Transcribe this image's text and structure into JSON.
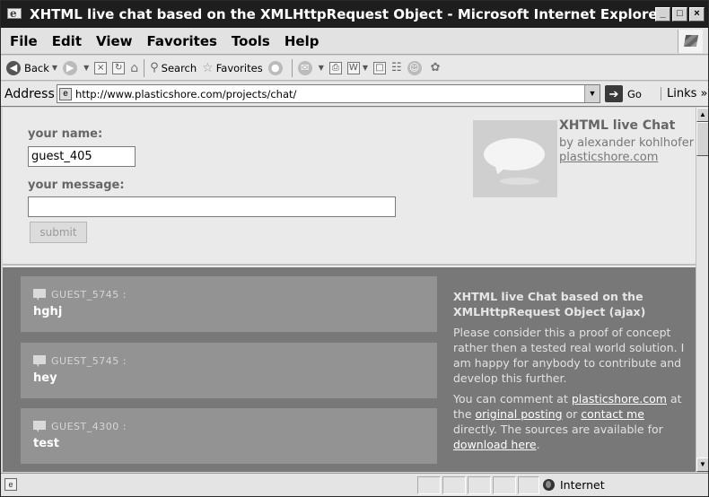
{
  "window": {
    "title": "XHTML live chat based on the XMLHttpRequest Object - Microsoft Internet Explorer",
    "controls": [
      "_",
      "□",
      "×"
    ]
  },
  "menu": [
    "File",
    "Edit",
    "View",
    "Favorites",
    "Tools",
    "Help"
  ],
  "toolbar": {
    "back": "Back",
    "search": "Search",
    "favorites": "Favorites"
  },
  "address": {
    "label": "Address",
    "url": "http://www.plasticshore.com/projects/chat/",
    "go": "Go",
    "links": "Links »"
  },
  "form": {
    "name_label": "your name:",
    "name_value": "guest_405",
    "message_label": "your message:",
    "message_value": "",
    "submit": "submit"
  },
  "brand": {
    "title": "XHTML live Chat",
    "by": "by alexander kohlhofer",
    "link": "plasticshore.com"
  },
  "messages": [
    {
      "user": "GUEST_5745 :",
      "text": "hghj"
    },
    {
      "user": "GUEST_5745 :",
      "text": "hey"
    },
    {
      "user": "GUEST_4300 :",
      "text": "test"
    }
  ],
  "sidebar": {
    "title": "XHTML live Chat based on the XMLHttpRequest Object (ajax)",
    "p1": "Please consider this a proof of concept rather then a tested real world solution. I am happy for anybody to contribute and develop this further.",
    "p2_a": "You can comment at ",
    "p2_link1": "plasticshore.com",
    "p2_b": " at the ",
    "p2_link2": "original posting",
    "p2_c": " or ",
    "p2_link3": "contact me",
    "p2_d": " directly. The sources are available for ",
    "p2_link4": "download here",
    "p2_e": "."
  },
  "status": {
    "zone": "Internet"
  }
}
